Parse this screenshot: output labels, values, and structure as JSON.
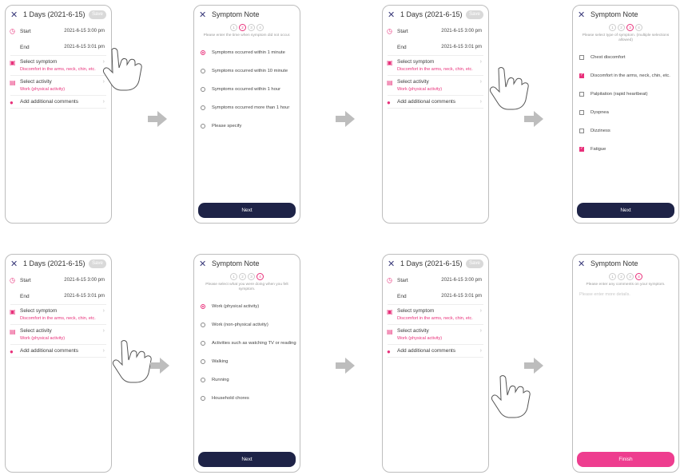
{
  "edit": {
    "title": "1 Days (2021-6-15)",
    "save": "Save",
    "start_label": "Start",
    "start_value": "2021-6-15 3:00 pm",
    "end_label": "End",
    "end_value_a": "2021-6-15 3:01 pm",
    "end_value_b": "2021-6-15 3:01 pm",
    "symptom_label": "Select symptom",
    "symptom_value": "Discomfort in the arms, neck, chin, etc.",
    "activity_label": "Select activity",
    "activity_value": "Work (physical activity)",
    "comments_label": "Add additional comments"
  },
  "note": {
    "title": "Symptom Note",
    "steps": [
      "1",
      "2",
      "3",
      "4"
    ],
    "time_instr": "Please enter the time when symptom did not occur.",
    "time_options": [
      "Symptoms occurred within 1 minute",
      "Symptoms occurred within 10 minute",
      "Symptoms occurred within 1 hour",
      "Symptoms occurred more than 1 hour",
      "Please specify"
    ],
    "type_instr": "Please select type of symptom. (multiple selections allowed)",
    "type_options": [
      "Chest discomfort",
      "Discomfort in the arms, neck, chin, etc.",
      "Palpitation (rapid heartbeat)",
      "Dyspnea",
      "Dizziness",
      "Fatigue"
    ],
    "activity_instr": "Please select what you were doing when you felt symptom.",
    "activity_options": [
      "Work (physical activity)",
      "Work (non-physical activity)",
      "Activities such as watching TV or reading",
      "Walking",
      "Running",
      "Household chores"
    ],
    "comment_instr": "Please enter any comments on your symptom.",
    "comment_placeholder": "Please enter more details.",
    "next": "Next",
    "finish": "Finish"
  },
  "colors": {
    "accent": "#e8307a",
    "navy": "#1e2347",
    "arrow": "#bdbdbd"
  },
  "icons": [
    "close-icon",
    "clock-icon",
    "calendar-icon",
    "briefcase-icon",
    "chat-icon",
    "chevron-right-icon",
    "arrow-right-icon",
    "tap-hand-icon"
  ]
}
